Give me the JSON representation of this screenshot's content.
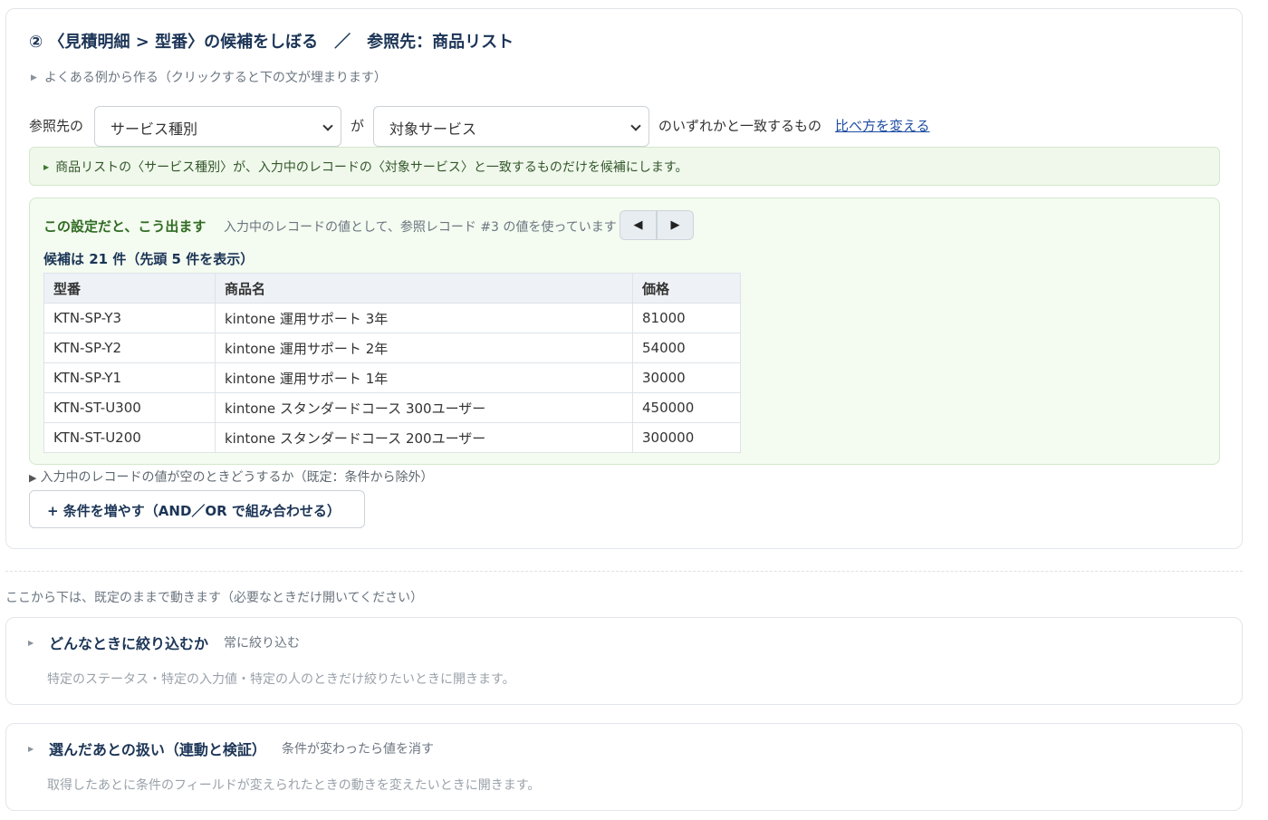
{
  "rule": {
    "title": "② 〈見積明細 > 型番〉の候補をしぼる　／　参照先：商品リスト",
    "examples_label": "よくある例から作る（クリックすると下の文が埋まります）",
    "prefix": "参照先の",
    "reference_field": "サービス種別",
    "connector": "が",
    "input_field": "対象サービス",
    "suffix": "のいずれかと一致するもの",
    "change_compare_link": "比べ方を変える",
    "hint": "商品リストの〈サービス種別〉が、入力中のレコードの〈対象サービス〉と一致するものだけを候補にします。"
  },
  "preview": {
    "heading": "この設定だと、こう出ます",
    "subtext": "入力中のレコードの値として、参照レコード #3 の値を使っています",
    "prev_icon": "◀",
    "next_icon": "▶",
    "count": "候補は 21 件（先頭 5 件を表示）",
    "columns": [
      "型番",
      "商品名",
      "価格"
    ],
    "rows": [
      [
        "KTN-SP-Y3",
        "kintone 運用サポート 3年",
        "81000"
      ],
      [
        "KTN-SP-Y2",
        "kintone 運用サポート 2年",
        "54000"
      ],
      [
        "KTN-SP-Y1",
        "kintone 運用サポート 1年",
        "30000"
      ],
      [
        "KTN-ST-U300",
        "kintone スタンダードコース 300ユーザー",
        "450000"
      ],
      [
        "KTN-ST-U200",
        "kintone スタンダードコース 200ユーザー",
        "300000"
      ]
    ]
  },
  "empty_value_label": "入力中のレコードの値が空のときどうするか（既定：条件から除外）",
  "add_condition_button": "+ 条件を増やす（AND／OR で組み合わせる）",
  "defaults_note": "ここから下は、既定のままで動きます（必要なときだけ開いてください）",
  "accordions": [
    {
      "title": "どんなときに絞り込むか",
      "value": "常に絞り込む",
      "description": "特定のステータス・特定の入力値・特定の人のときだけ絞りたいときに開きます。"
    },
    {
      "title": "選んだあとの扱い（連動と検証）",
      "value": "条件が変わったら値を消す",
      "description": "取得したあとに条件のフィールドが変えられたときの動きを変えたいときに開きます。"
    }
  ]
}
